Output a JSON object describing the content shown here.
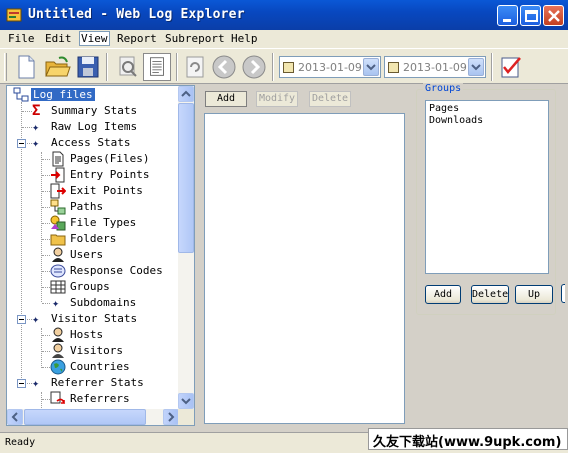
{
  "window": {
    "title": "Untitled - Web Log Explorer"
  },
  "menu": [
    "File",
    "Edit",
    "View",
    "Report",
    "Subreport",
    "Help"
  ],
  "toolbar": {
    "date_from": "2013-01-09",
    "date_to": "2013-01-09"
  },
  "tree": [
    {
      "label": "Log files",
      "icon": "network-icon",
      "selected": true
    },
    {
      "label": "Summary Stats",
      "icon": "sigma-icon"
    },
    {
      "label": "Raw Log Items",
      "icon": "star-icon"
    },
    {
      "label": "Access Stats",
      "icon": "star-icon"
    },
    {
      "label": "Pages(Files)",
      "icon": "page-icon"
    },
    {
      "label": "Entry Points",
      "icon": "entry-icon"
    },
    {
      "label": "Exit Points",
      "icon": "exit-icon"
    },
    {
      "label": "Paths",
      "icon": "paths-icon"
    },
    {
      "label": "File Types",
      "icon": "file-types-icon"
    },
    {
      "label": "Folders",
      "icon": "folder-icon"
    },
    {
      "label": "Users",
      "icon": "user-icon"
    },
    {
      "label": "Response Codes",
      "icon": "response-codes-icon"
    },
    {
      "label": "Groups",
      "icon": "groups-icon"
    },
    {
      "label": "Subdomains",
      "icon": "star-icon"
    },
    {
      "label": "Visitor Stats",
      "icon": "star-icon"
    },
    {
      "label": "Hosts",
      "icon": "host-icon"
    },
    {
      "label": "Visitors",
      "icon": "visitor-icon"
    },
    {
      "label": "Countries",
      "icon": "globe-icon"
    },
    {
      "label": "Referrer Stats",
      "icon": "star-icon"
    },
    {
      "label": "Referrers",
      "icon": "referrer-icon"
    }
  ],
  "list_buttons": {
    "add": "Add",
    "modify": "Modify",
    "delete": "Delete"
  },
  "groups": {
    "legend": "Groups",
    "items": [
      "Pages",
      "Downloads"
    ],
    "add": "Add",
    "delete": "Delete",
    "up": "Up"
  },
  "status": {
    "text": "Ready"
  },
  "watermark": {
    "text": "久友下载站(www.9upk.com)"
  }
}
